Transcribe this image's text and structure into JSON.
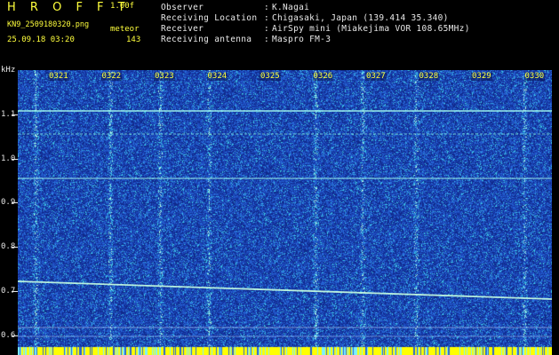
{
  "header": {
    "app_title": "H R O F F T",
    "version": "1.00f",
    "filename": "KN9_2509180320.png",
    "mode": "meteor",
    "datetime": "25.09.18 03:20",
    "count": "143"
  },
  "info": [
    {
      "label": "Observer",
      "value": "K.Nagai"
    },
    {
      "label": "Receiving Location",
      "value": "Chigasaki, Japan (139.414 35.340)"
    },
    {
      "label": "Receiver",
      "value": "AirSpy mini (Miakejima VOR 108.65MHz)"
    },
    {
      "label": "Receiving antenna",
      "value": "Maspro FM-3"
    }
  ],
  "axis": {
    "unit": "kHz",
    "y_ticks": [
      "1.1",
      "1.0",
      "0.9",
      "0.8",
      "0.7",
      "0.6"
    ],
    "time_labels": [
      "0321",
      "0322",
      "0323",
      "0324",
      "0325",
      "0326",
      "0327",
      "0328",
      "0329",
      "0330"
    ]
  },
  "colors": {
    "background": "#1a3ea8",
    "noise_dark": "#0f2a8c",
    "noise_light": "#2f6fd8",
    "signal": "#9dfbe8",
    "bottom_strip": "#ffff00",
    "text_yellow": "#ffff3c"
  }
}
